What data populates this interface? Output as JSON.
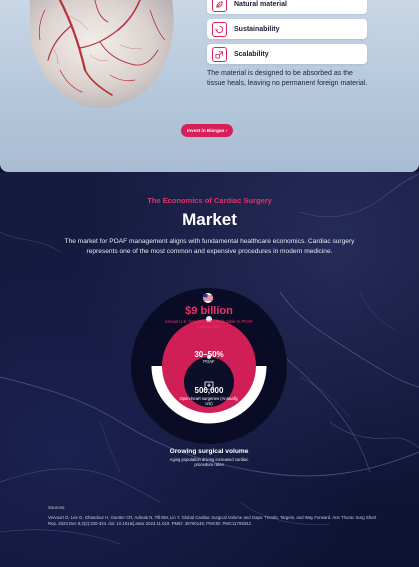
{
  "features": [
    {
      "label": "Natural material",
      "icon": "leaf-icon"
    },
    {
      "label": "Sustainability",
      "icon": "recycle-icon"
    },
    {
      "label": "Scalability",
      "icon": "scale-icon"
    }
  ],
  "description": "The material is designed to be absorbed as the tissue heals, leaving no permanent foreign material.",
  "invest_button": {
    "label": "Invest in Biorgan ›"
  },
  "market": {
    "eyebrow": "The Economics of Cardiac Surgery",
    "title": "Market",
    "intro": "The market for POAF management aligns with fundamental healthcare economics. Cardiac surgery represents one of the most common and expensive procedures in modern medicine."
  },
  "stats": {
    "cost": {
      "value": "$9 billion",
      "caption": "Annual U.S. hospital costs attributable to POAF complications",
      "icon": "us-flag-icon"
    },
    "poaf": {
      "value": "30–50%",
      "caption": "POAF"
    },
    "surgeries": {
      "value": "500,000",
      "caption": "Open-heart surgeries (Annually, US)",
      "icon": "hospital-icon"
    },
    "growing": {
      "title": "Growing surgical volume",
      "caption": "Aging population driving increased cardiac procedure rates"
    }
  },
  "colors": {
    "accent": "#d81f5a",
    "dark_bg": "#12163a",
    "outer_ring": "#0a0c26",
    "middle_ring": "#d01f57",
    "inner_ring": "#ffffff",
    "core": "#0c0e2a"
  },
  "sources": {
    "label": "Sources:",
    "text": "Vervoort D, Lee G, Ghandour H, Guetter CR, Adreak N, Till BM, Lin Y. Global Cardiac Surgical Volume and Gaps: Trends, Targets, and Way Forward. Ann Thorac Surg Short Rep. 2023 Dec 8;2(2):320-324. doi: 10.1016/j.atssr.2023.11.019. PMID: 39790145; PMCID: PMC11708342."
  }
}
